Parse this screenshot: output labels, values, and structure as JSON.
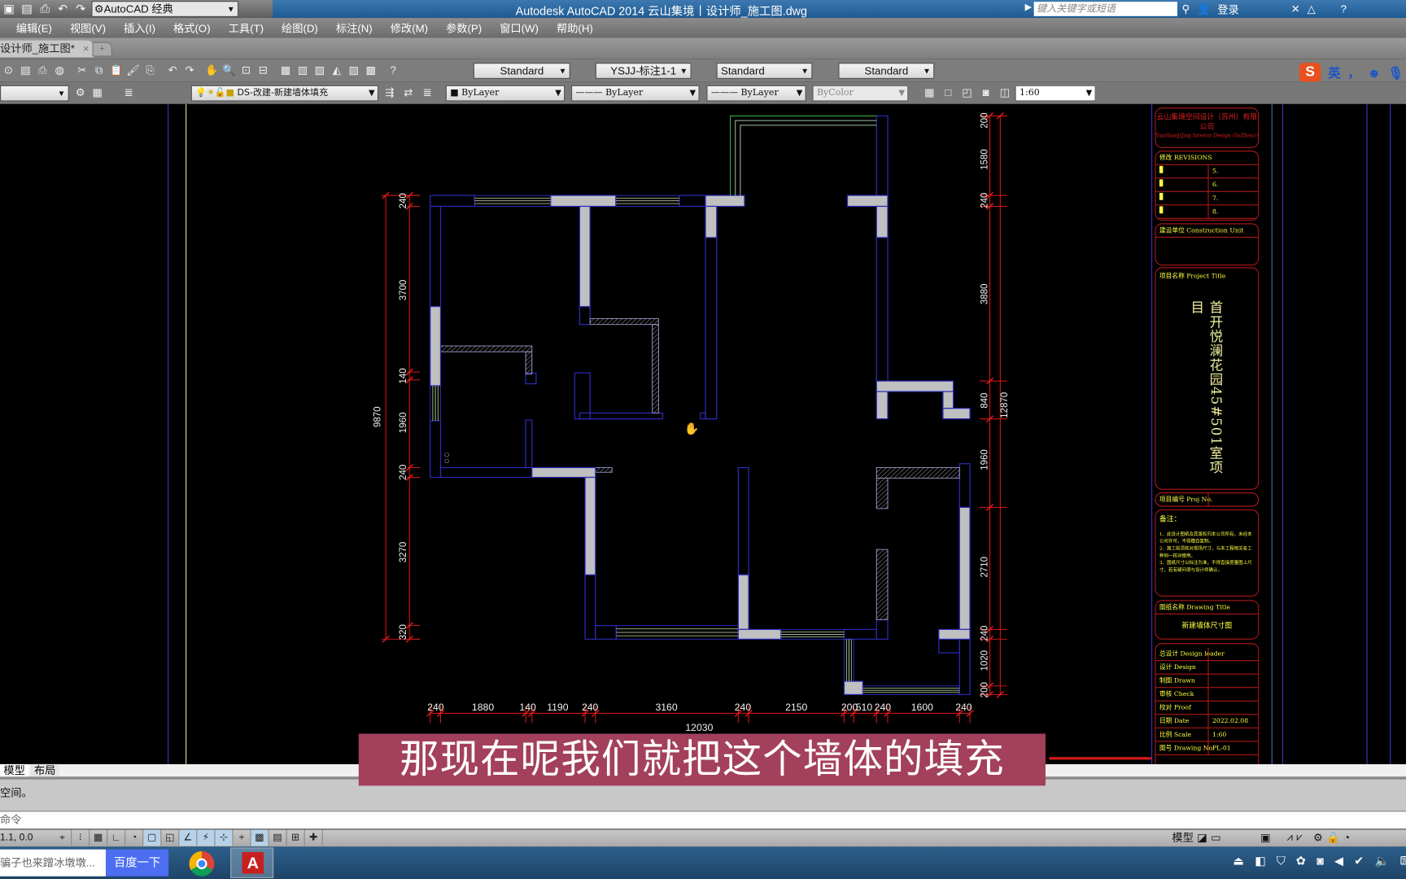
{
  "titlebar": {
    "workspace": "AutoCAD 经典",
    "title": "Autodesk AutoCAD 2014    云山集境丨设计师_施工图.dwg",
    "search_placeholder": "键入关键字或短语",
    "login": "登录"
  },
  "menu": [
    "编辑(E)",
    "视图(V)",
    "插入(I)",
    "格式(O)",
    "工具(T)",
    "绘图(D)",
    "标注(N)",
    "修改(M)",
    "参数(P)",
    "窗口(W)",
    "帮助(H)"
  ],
  "doc_tab": {
    "label": "设计师_施工图*",
    "close": "×"
  },
  "toolbar1": {
    "text_style": "Standard",
    "dim_style": "YSJJ-标注1-1",
    "table_style": "Standard",
    "mleader_style": "Standard"
  },
  "toolbar2": {
    "layer": "DS-改建-新建墙体填充",
    "color": "ByLayer",
    "linetype": "ByLayer",
    "lineweight": "ByLayer",
    "plotstyle": "ByColor",
    "scale": "1:60"
  },
  "ime": {
    "mode": "英",
    "punct": "，"
  },
  "drawing": {
    "dims_left": [
      "240",
      "3700",
      "140",
      "1960",
      "240",
      "3270",
      "320"
    ],
    "dim_left_total": "9870",
    "dims_right": [
      "200",
      "1580",
      "240",
      "3880",
      "840",
      "1960",
      "2710",
      "240",
      "1020",
      "200"
    ],
    "dim_right_total": "12870",
    "dims_bottom": [
      "240",
      "1880",
      "140",
      "1190",
      "240",
      "3160",
      "240",
      "2150",
      "200",
      "510",
      "240",
      "1600",
      "240"
    ],
    "dim_bottom_total": "12030"
  },
  "title_block": {
    "company": "云山集境空间设计（苏州）有限公司",
    "company_en": "YunShanJiJing Interior Design (SuZhou) Co.,Ltd",
    "revisions_label": "修改 REVISIONS",
    "revisions": [
      "5.",
      "6.",
      "7.",
      "8."
    ],
    "construction_unit": "建设单位 Construction Unit",
    "project_title_label": "项目名称 Project Title",
    "project_title": "首开悦澜花园45#501室项目",
    "project_no": "项目编号 Proj No.",
    "notes_label": "备注：",
    "notes": [
      "1、此设计图纸及其版权归本公司所有，未经本公司许可，不得擅自复制。",
      "2、施工前须核对现场尺寸，与本工程相关各工种同一核对使用。",
      "3、图纸尺寸以标注为准，不得直接度量图上尺寸，若有疑问须与设计师确认。"
    ],
    "drawing_title_label": "图纸名称 Drawing Title",
    "drawing_title": "新建墙体尺寸图",
    "rows": [
      {
        "label": "总设计 Design leader",
        "value": ""
      },
      {
        "label": "设计 Design",
        "value": ""
      },
      {
        "label": "制图 Drawn",
        "value": ""
      },
      {
        "label": "审核 Check",
        "value": ""
      },
      {
        "label": "校对 Proof",
        "value": ""
      },
      {
        "label": "日期 Date",
        "value": "2022.02.08"
      },
      {
        "label": "比例 Scale",
        "value": "1:60"
      },
      {
        "label": "图号 Drawing No.",
        "value": "PL-01"
      }
    ]
  },
  "layout_tabs": [
    "模型",
    "布局"
  ],
  "command": {
    "history": "空间。",
    "prompt": "命令"
  },
  "status": {
    "coords": "1.1, 0.0",
    "model": "模型"
  },
  "taskbar": {
    "search_text": "骗子也来蹭冰墩墩...",
    "search_button": "百度一下"
  },
  "subtitle": "那现在呢我们就把这个墙体的填充",
  "colors": {
    "wall_fill": "#c0c0c0",
    "wall_line": "#2a2ab8",
    "dim": "#e01818",
    "subtitle_bg": "#a3405c"
  }
}
